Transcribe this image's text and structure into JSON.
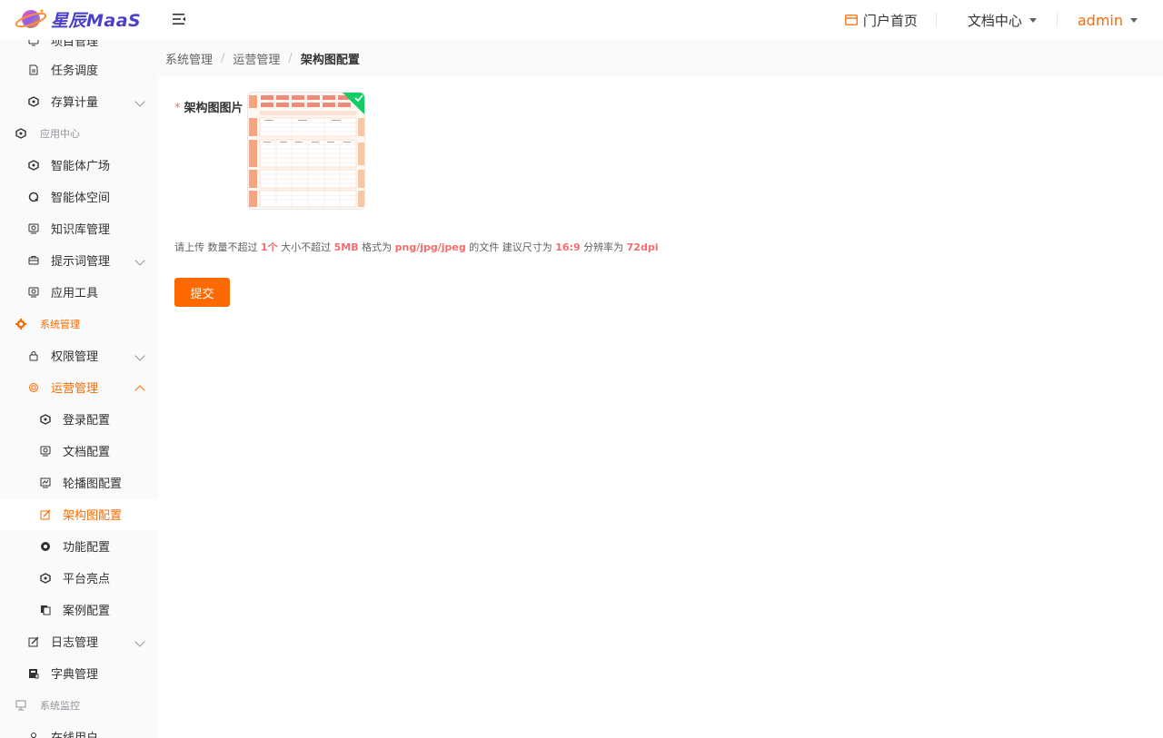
{
  "header": {
    "logo_text": "星辰MaaS",
    "portal_label": "门户首页",
    "docs_label": "文档中心",
    "user_label": "admin"
  },
  "sidebar": {
    "items": [
      {
        "label": "项目管理",
        "icon": "monitor-icon"
      },
      {
        "label": "任务调度",
        "icon": "document-icon"
      },
      {
        "label": "存算计量",
        "icon": "cube-icon"
      },
      {
        "label": "应用中心",
        "icon": "cube-icon"
      },
      {
        "label": "智能体广场",
        "icon": "cube-icon"
      },
      {
        "label": "智能体空间",
        "icon": "search-circle-icon"
      },
      {
        "label": "知识库管理",
        "icon": "monitor-icon"
      },
      {
        "label": "提示词管理",
        "icon": "briefcase-icon"
      },
      {
        "label": "应用工具",
        "icon": "monitor-icon"
      },
      {
        "label": "系统管理",
        "icon": "gear-icon"
      },
      {
        "label": "权限管理",
        "icon": "lock-icon"
      },
      {
        "label": "运营管理",
        "icon": "cpu-icon"
      },
      {
        "label": "登录配置",
        "icon": "cube-icon"
      },
      {
        "label": "文档配置",
        "icon": "monitor-icon"
      },
      {
        "label": "轮播图配置",
        "icon": "chart-monitor-icon"
      },
      {
        "label": "架构图配置",
        "icon": "edit-icon"
      },
      {
        "label": "功能配置",
        "icon": "aperture-icon"
      },
      {
        "label": "平台亮点",
        "icon": "cube-icon"
      },
      {
        "label": "案例配置",
        "icon": "copy-icon"
      },
      {
        "label": "日志管理",
        "icon": "edit-icon"
      },
      {
        "label": "字典管理",
        "icon": "book-icon"
      },
      {
        "label": "系统监控",
        "icon": "monitor-icon"
      },
      {
        "label": "在线用户",
        "icon": "user-icon"
      }
    ]
  },
  "breadcrumb": [
    "系统管理",
    "运营管理",
    "架构图配置"
  ],
  "form": {
    "label": "架构图图片",
    "tip": {
      "prefix": "请上传 数量不超过",
      "count": "1个",
      "size_prefix": "大小不超过",
      "size": "5MB",
      "fmt_prefix": "格式为",
      "fmt": "png/jpg/jpeg",
      "size_hint_prefix": "的文件 建议尺寸为",
      "ratio": "16:9",
      "dpi_prefix": "分辨率为",
      "dpi": "72dpi"
    },
    "submit_label": "提交"
  },
  "colors": {
    "accent": "#ff6a00",
    "required": "#f56c6c",
    "success": "#13ce66"
  }
}
